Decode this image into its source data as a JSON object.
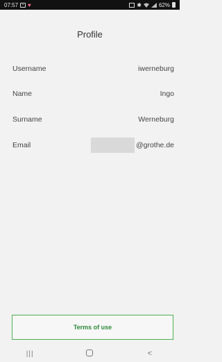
{
  "status_bar": {
    "time": "07:57",
    "battery": "62%",
    "icons": [
      "image-icon",
      "heart-icon",
      "cast-icon",
      "bluetooth-icon",
      "wifi-icon",
      "signal-icon",
      "battery-icon"
    ]
  },
  "header": {
    "title": "Profile"
  },
  "profile": {
    "fields": [
      {
        "label": "Username",
        "value": "iwerneburg"
      },
      {
        "label": "Name",
        "value": "Ingo"
      },
      {
        "label": "Surname",
        "value": "Werneburg"
      },
      {
        "label": "Email",
        "value": "@grothe.de"
      }
    ]
  },
  "footer": {
    "terms_label": "Terms of use"
  },
  "nav": {
    "recents": "|||",
    "back": "<"
  },
  "colors": {
    "accent": "#4caf50",
    "background": "#f2f2f2"
  }
}
